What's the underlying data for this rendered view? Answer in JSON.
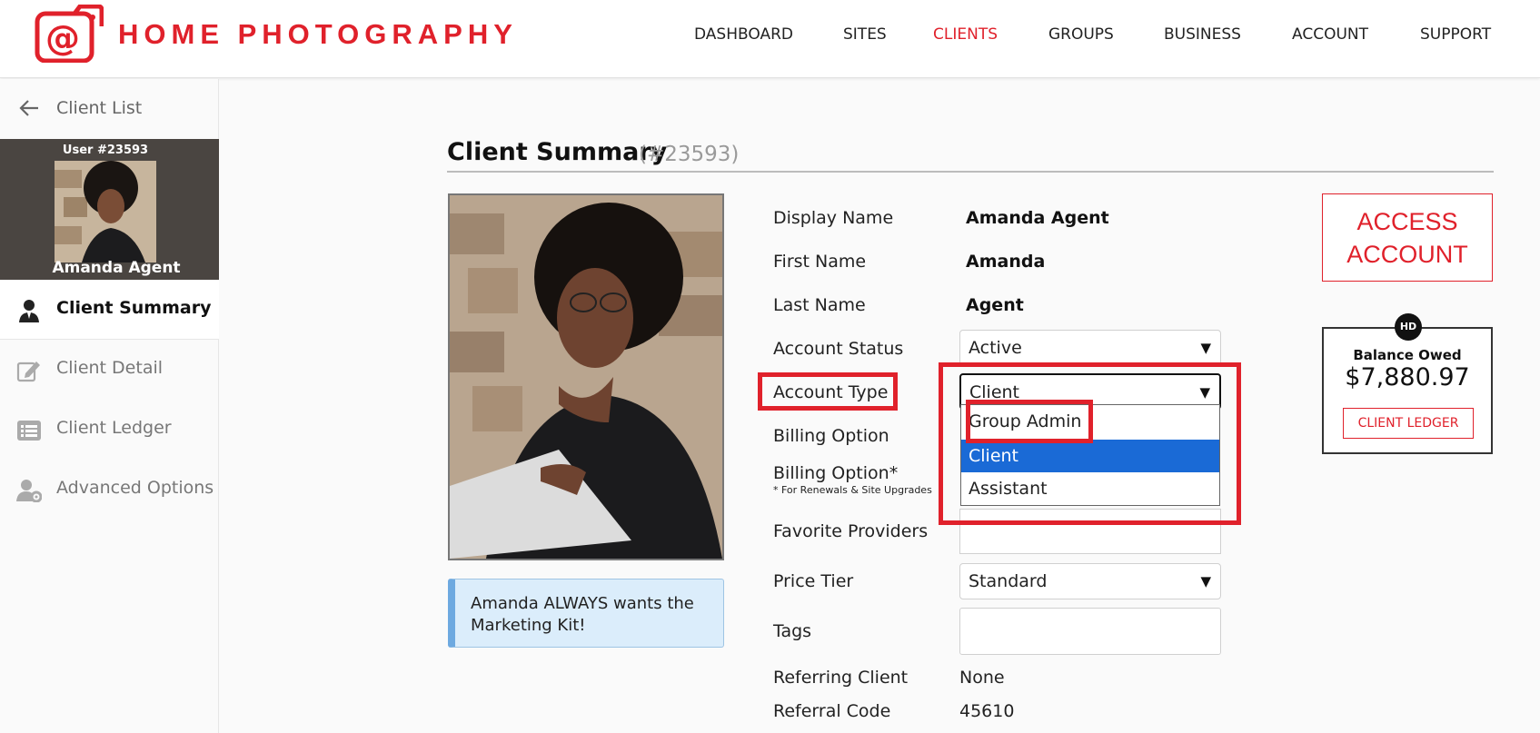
{
  "brand": {
    "name": "HOME PHOTOGRAPHY"
  },
  "nav": {
    "items": [
      "DASHBOARD",
      "SITES",
      "CLIENTS",
      "GROUPS",
      "BUSINESS",
      "ACCOUNT",
      "SUPPORT"
    ],
    "active": "CLIENTS"
  },
  "sidebar": {
    "back_label": "Client List",
    "user_id": "User #23593",
    "user_name": "Amanda Agent",
    "items": [
      {
        "label": "Client Summary",
        "icon": "user-suit-icon",
        "active": true
      },
      {
        "label": "Client Detail",
        "icon": "edit-icon"
      },
      {
        "label": "Client Ledger",
        "icon": "list-icon"
      },
      {
        "label": "Advanced Options",
        "icon": "user-gear-icon"
      }
    ]
  },
  "page": {
    "title": "Client Summary",
    "id": "(#23593)"
  },
  "note": "Amanda ALWAYS wants the Marketing Kit!",
  "fields": {
    "display_name": {
      "label": "Display Name",
      "value": "Amanda Agent"
    },
    "first_name": {
      "label": "First Name",
      "value": "Amanda"
    },
    "last_name": {
      "label": "Last Name",
      "value": "Agent"
    },
    "account_status": {
      "label": "Account Status",
      "value": "Active"
    },
    "account_type": {
      "label": "Account Type",
      "value": "Client",
      "options": [
        "Group Admin",
        "Client",
        "Assistant"
      ]
    },
    "billing_option": {
      "label": "Billing Option"
    },
    "billing_option2": {
      "label": "Billing Option*",
      "note": "* For Renewals & Site Upgrades"
    },
    "favorite_providers": {
      "label": "Favorite Providers"
    },
    "price_tier": {
      "label": "Price Tier",
      "value": "Standard"
    },
    "tags": {
      "label": "Tags"
    },
    "referring_client": {
      "label": "Referring Client",
      "value": "None"
    },
    "referral_code": {
      "label": "Referral Code",
      "value": "45610"
    }
  },
  "access_button": {
    "label": "ACCESS ACCOUNT"
  },
  "balance": {
    "badge": "HD",
    "label": "Balance Owed",
    "amount": "$7,880.97",
    "ledger_button": "CLIENT LEDGER"
  },
  "colors": {
    "brand": "#e0212b",
    "selected_option": "#1a6ad6",
    "note_bg": "#dbedfb",
    "annotation": "#e0212b"
  }
}
